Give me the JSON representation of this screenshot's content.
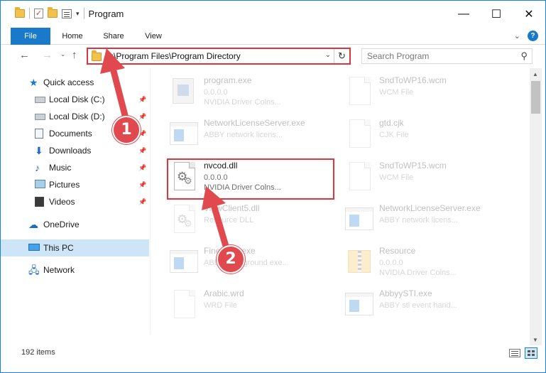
{
  "window": {
    "title": "Program",
    "minimize": "—",
    "maximize": "☐",
    "close": "✕"
  },
  "ribbon": {
    "tabs": [
      "File",
      "Home",
      "Share",
      "View"
    ],
    "expand": "⌄",
    "help": "?"
  },
  "nav": {
    "back": "←",
    "forward": "→",
    "recent": "⌄",
    "up": "↑",
    "address": "C:\\Program Files\\Program Directory",
    "address_dropdown": "⌄",
    "refresh": "↻",
    "search_placeholder": "Search Program",
    "search_icon": "⚲"
  },
  "sidebar": {
    "items": [
      {
        "label": "Quick access",
        "icon": "star-icon"
      },
      {
        "label": "Local Disk (C:)",
        "icon": "disk-icon",
        "pinned": true
      },
      {
        "label": "Local Disk (D:)",
        "icon": "disk-icon",
        "pinned": true
      },
      {
        "label": "Documents",
        "icon": "documents-icon",
        "pinned": true
      },
      {
        "label": "Downloads",
        "icon": "download-icon",
        "pinned": true
      },
      {
        "label": "Music",
        "icon": "music-icon",
        "pinned": true
      },
      {
        "label": "Pictures",
        "icon": "pictures-icon",
        "pinned": true
      },
      {
        "label": "Videos",
        "icon": "videos-icon",
        "pinned": true
      },
      {
        "label": "OneDrive",
        "icon": "cloud-icon"
      },
      {
        "label": "This PC",
        "icon": "computer-icon",
        "selected": true
      },
      {
        "label": "Network",
        "icon": "network-icon"
      }
    ],
    "pin_glyph": "📌"
  },
  "files": [
    {
      "name": "program.exe",
      "meta1": "0.0.0.0",
      "meta2": "NVIDIA Driver Colns...",
      "icon": "setup-icon"
    },
    {
      "name": "SndToWP16.wcm",
      "meta1": "WCM File",
      "meta2": "",
      "icon": "document-icon"
    },
    {
      "name": "NetworkLicenseServer.exe",
      "meta1": "ABBY network licens...",
      "meta2": "",
      "icon": "application-icon"
    },
    {
      "name": "gtd.cjk",
      "meta1": "CJK File",
      "meta2": "",
      "icon": "document-icon"
    },
    {
      "name": "nvcod.dll",
      "meta1": "0.0.0.0",
      "meta2": "NVIDIA Driver Colns...",
      "icon": "gear-dll-icon"
    },
    {
      "name": "SndToWP15.wcm",
      "meta1": "WCM File",
      "meta2": "",
      "icon": "document-icon"
    },
    {
      "name": "ViewClient5.dll",
      "meta1": "Resource DLL",
      "meta2": "",
      "icon": "gear-dll-icon"
    },
    {
      "name": "NetworkLicenseServer.exe",
      "meta1": "ABBY network licens...",
      "meta2": "",
      "icon": "application-icon"
    },
    {
      "name": "FineExec.exe",
      "meta1": "ABBY background exe...",
      "meta2": "",
      "icon": "application-icon"
    },
    {
      "name": "Resource",
      "meta1": "0.0.0.0",
      "meta2": "NVIDIA Driver Colns...",
      "icon": "archive-icon"
    },
    {
      "name": "Arabic.wrd",
      "meta1": "WRD File",
      "meta2": "",
      "icon": "document-icon"
    },
    {
      "name": "AbbyySTI.exe",
      "meta1": "ABBY sti event hand...",
      "meta2": "",
      "icon": "application-icon"
    }
  ],
  "status": {
    "count": "192 items"
  },
  "callouts": {
    "step1": "1",
    "step2": "2"
  },
  "colors": {
    "accent": "#1979ca",
    "highlight": "#d9363e",
    "marker": "#e04a4f",
    "selected": "#cde5f7"
  }
}
